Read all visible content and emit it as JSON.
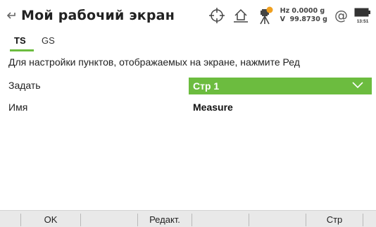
{
  "header": {
    "title": "Мой рабочий экран",
    "hz": "Hz 0.0000 g",
    "v": "V  99.8730 g",
    "at_symbol": "@",
    "time": "13:51"
  },
  "tabs": [
    {
      "label": "TS",
      "active": true
    },
    {
      "label": "GS",
      "active": false
    }
  ],
  "hint": "Для настройки пунктов, отображаемых на экране, нажмите Ред",
  "fields": {
    "set_label": "Задать",
    "set_value": "Стр 1",
    "name_label": "Имя",
    "name_value": "Measure"
  },
  "softkeys": [
    "OK",
    "",
    "Редакт.",
    "",
    "",
    "Стр"
  ],
  "colors": {
    "accent": "#6cbc3f",
    "softkey_bg": "#e9e9e9"
  },
  "icons": {
    "back": "back-arrow-icon",
    "target": "crosshair-target-icon",
    "home": "home-icon",
    "instrument": "instrument-alert-icon",
    "battery": "battery-icon",
    "dropdown": "chevron-down-icon"
  }
}
